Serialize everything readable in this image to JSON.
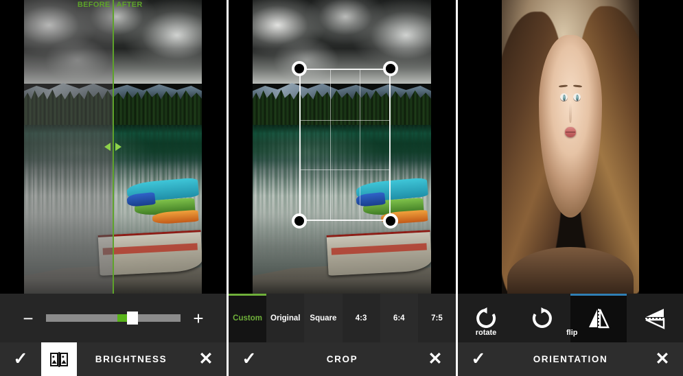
{
  "app": {
    "panels": [
      {
        "id": "brightness",
        "title": "BRIGHTNESS",
        "confirm_label": "✓",
        "cancel_label": "✕",
        "compare_icon": "compare-split-image-icon",
        "slider": {
          "decrease_label": "−",
          "increase_label": "+",
          "value_percent": 53,
          "track_color": "#8b8b8b",
          "fill_color": "#58b319",
          "thumb_color": "#fdfdfd"
        },
        "overlay": {
          "before_label": "BEFORE",
          "after_label": "AFTER",
          "divider_color": "#5ea32a",
          "arrow_left_icon": "arrow-left-icon",
          "arrow_right_icon": "arrow-right-icon"
        }
      },
      {
        "id": "crop",
        "title": "CROP",
        "confirm_label": "✓",
        "cancel_label": "✕",
        "selected_ratio": "Custom",
        "accent_color": "#6fb03a",
        "ratios": [
          {
            "label": "Custom",
            "selected": true
          },
          {
            "label": "Original",
            "selected": false
          },
          {
            "label": "Square",
            "selected": false
          },
          {
            "label": "4:3",
            "selected": false
          },
          {
            "label": "6:4",
            "selected": false
          },
          {
            "label": "7:5",
            "selected": false
          }
        ],
        "crop_box": {
          "handles": [
            "top-left",
            "top-right",
            "bottom-left",
            "bottom-right"
          ],
          "grid": "rule-of-thirds"
        }
      },
      {
        "id": "orientation",
        "title": "ORIENTATION",
        "confirm_label": "✓",
        "cancel_label": "✕",
        "accent_color": "#2f7fb5",
        "groups": [
          {
            "label": "rotate",
            "buttons": [
              {
                "icon": "rotate-counter-clockwise-icon",
                "selected": false
              },
              {
                "icon": "rotate-clockwise-icon",
                "selected": false
              }
            ]
          },
          {
            "label": "flip",
            "buttons": [
              {
                "icon": "flip-horizontal-icon",
                "selected": true
              },
              {
                "icon": "flip-vertical-icon",
                "selected": false
              }
            ]
          }
        ]
      }
    ]
  }
}
